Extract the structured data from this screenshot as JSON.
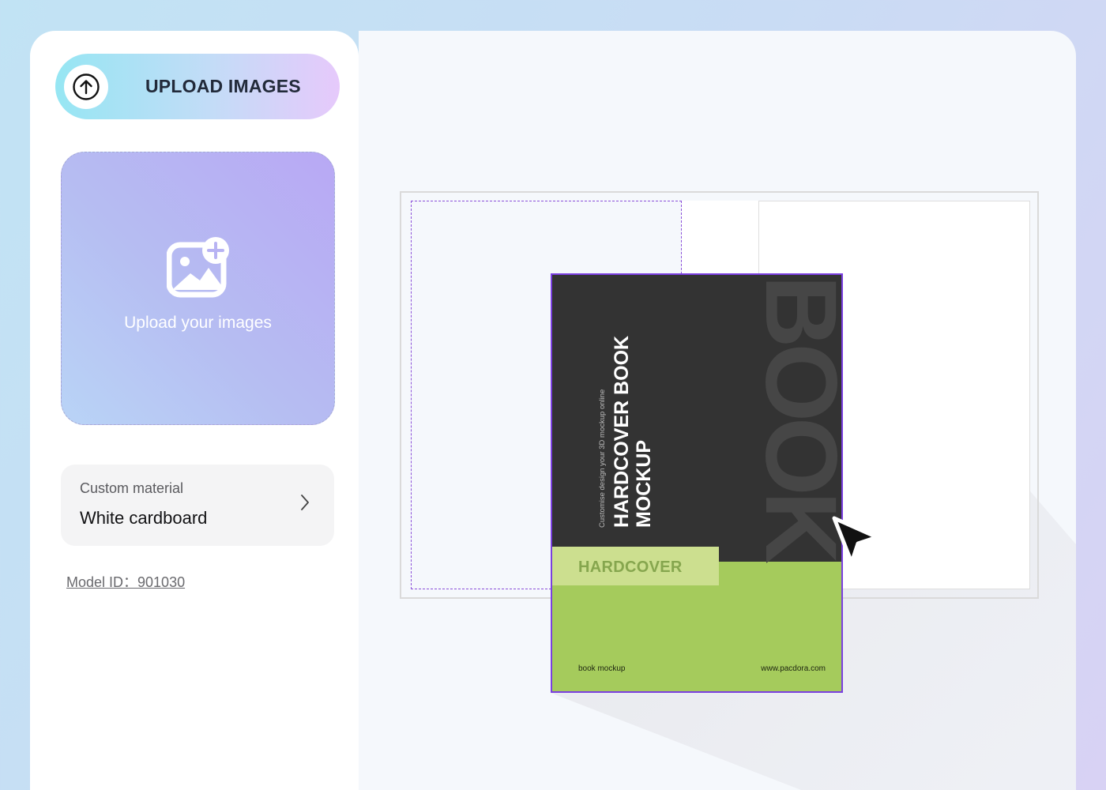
{
  "sidebar": {
    "upload_button": {
      "label": "UPLOAD IMAGES",
      "icon": "arrow-up-circle-icon"
    },
    "dropzone": {
      "label": "Upload your images",
      "icon": "image-add-icon"
    },
    "material": {
      "caption": "Custom material",
      "value": "White cardboard",
      "icon": "chevron-right-icon"
    },
    "model_id": "Model ID：901030"
  },
  "canvas": {
    "cover": {
      "tagline": "Customise design your 3D mockup online",
      "title_line1": "HARDCOVER BOOK",
      "title_line2": "MOCKUP",
      "watermark": "BOOK",
      "tag": "HARDCOVER",
      "footer_left": "book mockup",
      "footer_right": "www.pacdora.com"
    },
    "colors": {
      "cover_dark": "#333333",
      "cover_green": "#a5cb5c",
      "tag_green": "#ccdf8f",
      "selection": "#7a3fe0"
    }
  }
}
